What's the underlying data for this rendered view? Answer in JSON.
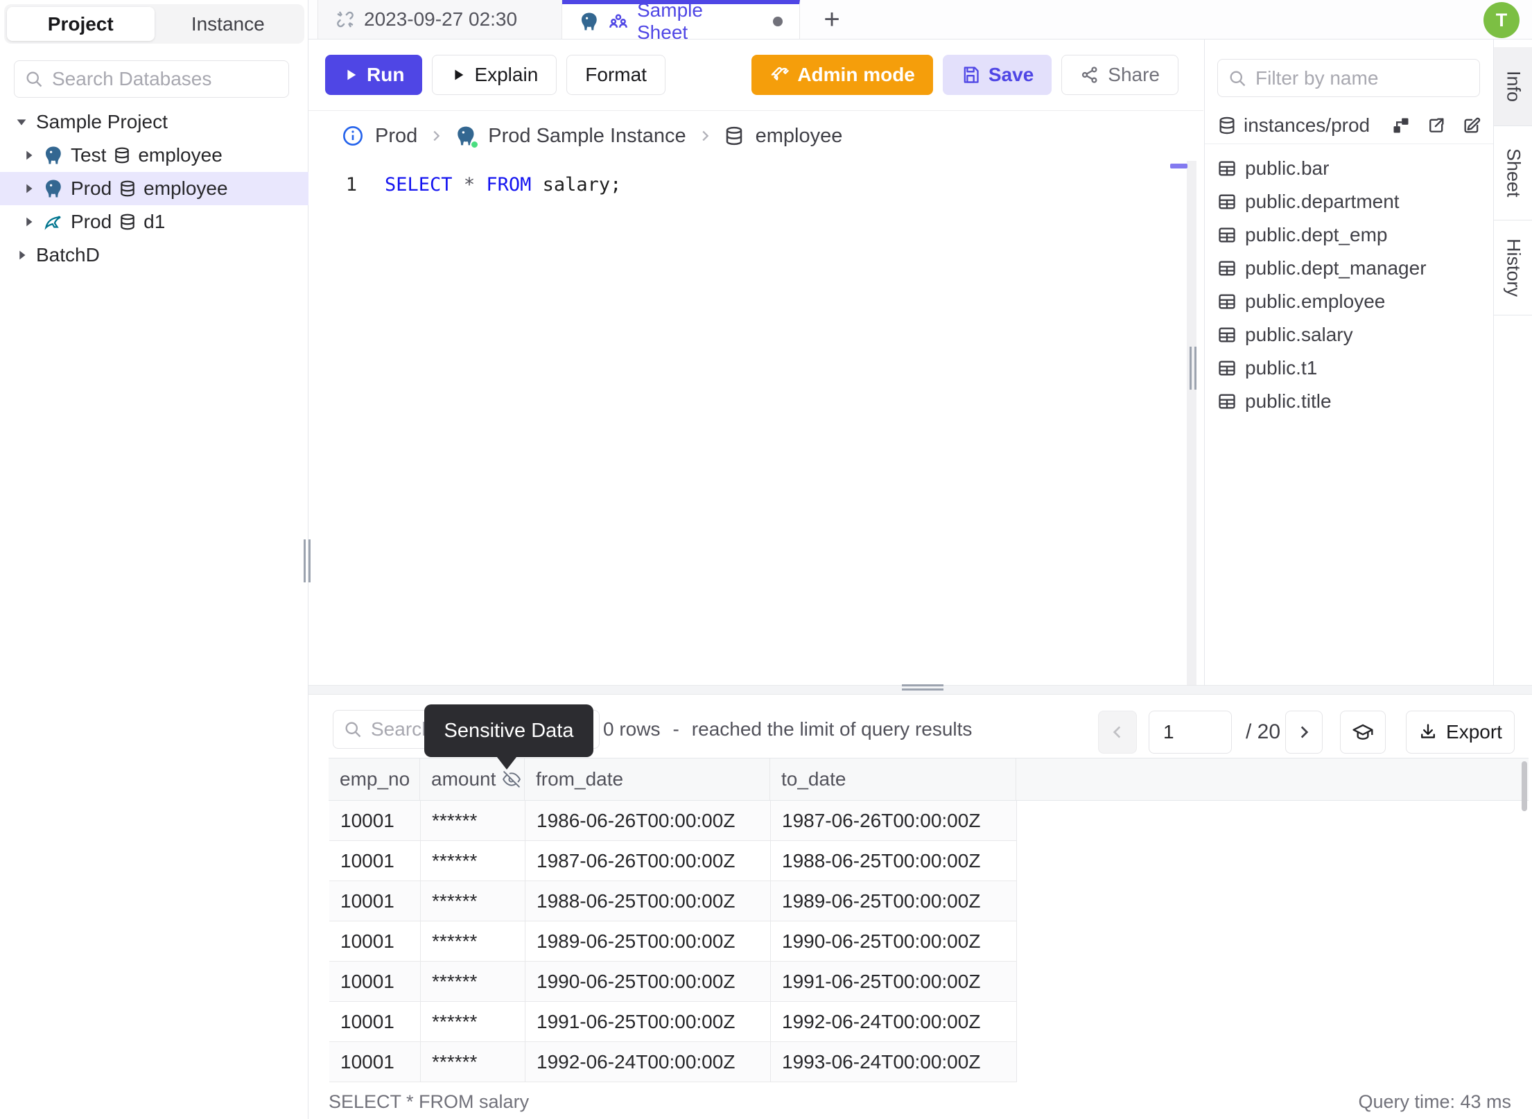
{
  "avatar": {
    "initial": "T"
  },
  "sidebar": {
    "tabs": [
      {
        "label": "Project"
      },
      {
        "label": "Instance"
      }
    ],
    "search_placeholder": "Search Databases",
    "tree": {
      "project": {
        "label": "Sample Project"
      },
      "items": [
        {
          "engine": "postgres",
          "env": "Test",
          "db": "employee"
        },
        {
          "engine": "postgres",
          "env": "Prod",
          "db": "employee",
          "selected": true
        },
        {
          "engine": "mysql",
          "env": "Prod",
          "db": "d1"
        }
      ],
      "project2": {
        "label": "BatchD"
      }
    }
  },
  "editor_tabs": {
    "tab1": {
      "label": "2023-09-27 02:30"
    },
    "tab2": {
      "label": "Sample Sheet"
    },
    "add_label": "+"
  },
  "toolbar": {
    "run_label": "Run",
    "explain_label": "Explain",
    "format_label": "Format",
    "admin_label": "Admin mode",
    "save_label": "Save",
    "share_label": "Share"
  },
  "breadcrumb": {
    "environment": "Prod",
    "instance": "Prod Sample Instance",
    "database": "employee"
  },
  "editor": {
    "line_number": "1",
    "kw_select": "SELECT",
    "star": "*",
    "kw_from": "FROM",
    "rest": "salary;"
  },
  "schema_panel": {
    "filter_placeholder": "Filter by name",
    "scope": "instances/prod",
    "tables": [
      "public.bar",
      "public.department",
      "public.dept_emp",
      "public.dept_manager",
      "public.employee",
      "public.salary",
      "public.t1",
      "public.title"
    ]
  },
  "side_tabs": [
    "Info",
    "Sheet",
    "History"
  ],
  "results": {
    "search_placeholder": "Search",
    "tooltip": "Sensitive Data",
    "rows_count": "0 rows",
    "separator": "-",
    "limit_text": "reached the limit of query results",
    "pagination": {
      "page": "1",
      "total": "/ 20"
    },
    "export_label": "Export",
    "table": {
      "columns": [
        "emp_no",
        "amount",
        "from_date",
        "to_date"
      ],
      "rows": [
        [
          "10001",
          "******",
          "1986-06-26T00:00:00Z",
          "1987-06-26T00:00:00Z"
        ],
        [
          "10001",
          "******",
          "1987-06-26T00:00:00Z",
          "1988-06-25T00:00:00Z"
        ],
        [
          "10001",
          "******",
          "1988-06-25T00:00:00Z",
          "1989-06-25T00:00:00Z"
        ],
        [
          "10001",
          "******",
          "1989-06-25T00:00:00Z",
          "1990-06-25T00:00:00Z"
        ],
        [
          "10001",
          "******",
          "1990-06-25T00:00:00Z",
          "1991-06-25T00:00:00Z"
        ],
        [
          "10001",
          "******",
          "1991-06-25T00:00:00Z",
          "1992-06-24T00:00:00Z"
        ],
        [
          "10001",
          "******",
          "1992-06-24T00:00:00Z",
          "1993-06-24T00:00:00Z"
        ]
      ]
    },
    "status_query": "SELECT * FROM salary",
    "query_time": "Query time: 43 ms"
  },
  "colors": {
    "accent": "#4f46e5",
    "admin_orange": "#f59e0b",
    "avatar_green": "#7cbf43",
    "keyword_blue": "#1414f0",
    "selected_row": "#e9e7fd",
    "status_green": "#4ade80"
  }
}
